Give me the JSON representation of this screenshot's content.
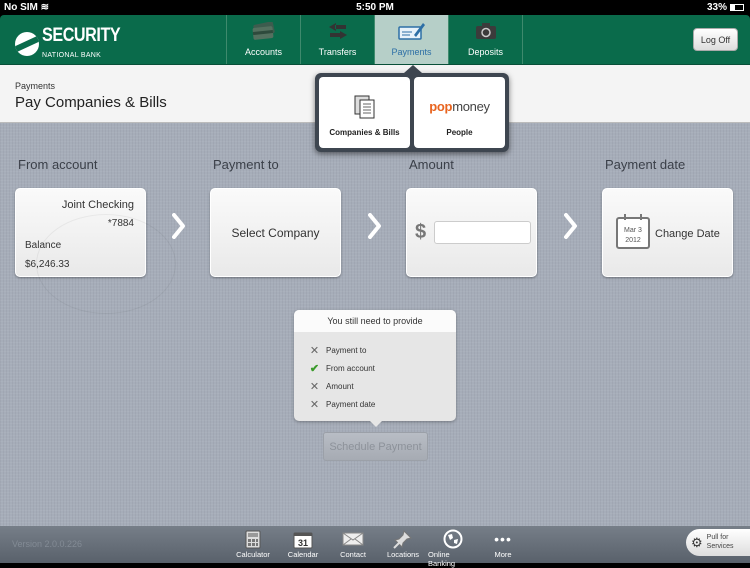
{
  "status_bar": {
    "carrier": "No SIM",
    "time": "5:50 PM",
    "battery": "33%"
  },
  "header": {
    "brand_name": "SECURITY",
    "brand_sub": "NATIONAL BANK",
    "logoff_label": "Log Off",
    "tabs": [
      {
        "label": "Accounts",
        "icon": "credit-cards-icon"
      },
      {
        "label": "Transfers",
        "icon": "transfer-arrows-icon"
      },
      {
        "label": "Payments",
        "icon": "check-pen-icon",
        "active": true
      },
      {
        "label": "Deposits",
        "icon": "camera-icon"
      }
    ]
  },
  "subheader": {
    "breadcrumb": "Payments",
    "title": "Pay Companies & Bills"
  },
  "payments_menu": {
    "items": [
      {
        "label": "Companies & Bills",
        "icon": "documents-icon"
      },
      {
        "label": "People",
        "brand_pop": "pop",
        "brand_money": "money"
      }
    ]
  },
  "steps": {
    "from": {
      "label": "From account",
      "account_name": "Joint Checking",
      "account_number": "*7884",
      "balance_label": "Balance",
      "balance_value": "$6,246.33"
    },
    "to": {
      "label": "Payment to",
      "action": "Select Company"
    },
    "amount": {
      "label": "Amount",
      "currency": "$",
      "value": ""
    },
    "date": {
      "label": "Payment date",
      "cal_month_day": "Mar 3",
      "cal_year": "2012",
      "action": "Change Date"
    }
  },
  "requirements": {
    "title": "You still need to provide",
    "items": [
      {
        "label": "Payment to",
        "done": false
      },
      {
        "label": "From account",
        "done": true
      },
      {
        "label": "Amount",
        "done": false
      },
      {
        "label": "Payment date",
        "done": false
      }
    ]
  },
  "schedule_button": "Schedule Payment",
  "footer": {
    "version": "Version 2.0.0.226",
    "items": [
      "Calculator",
      "Calendar",
      "Contact",
      "Locations",
      "Online Banking",
      "More"
    ],
    "calendar_day": "31",
    "pull_line1": "Pull for",
    "pull_line2": "Services"
  }
}
